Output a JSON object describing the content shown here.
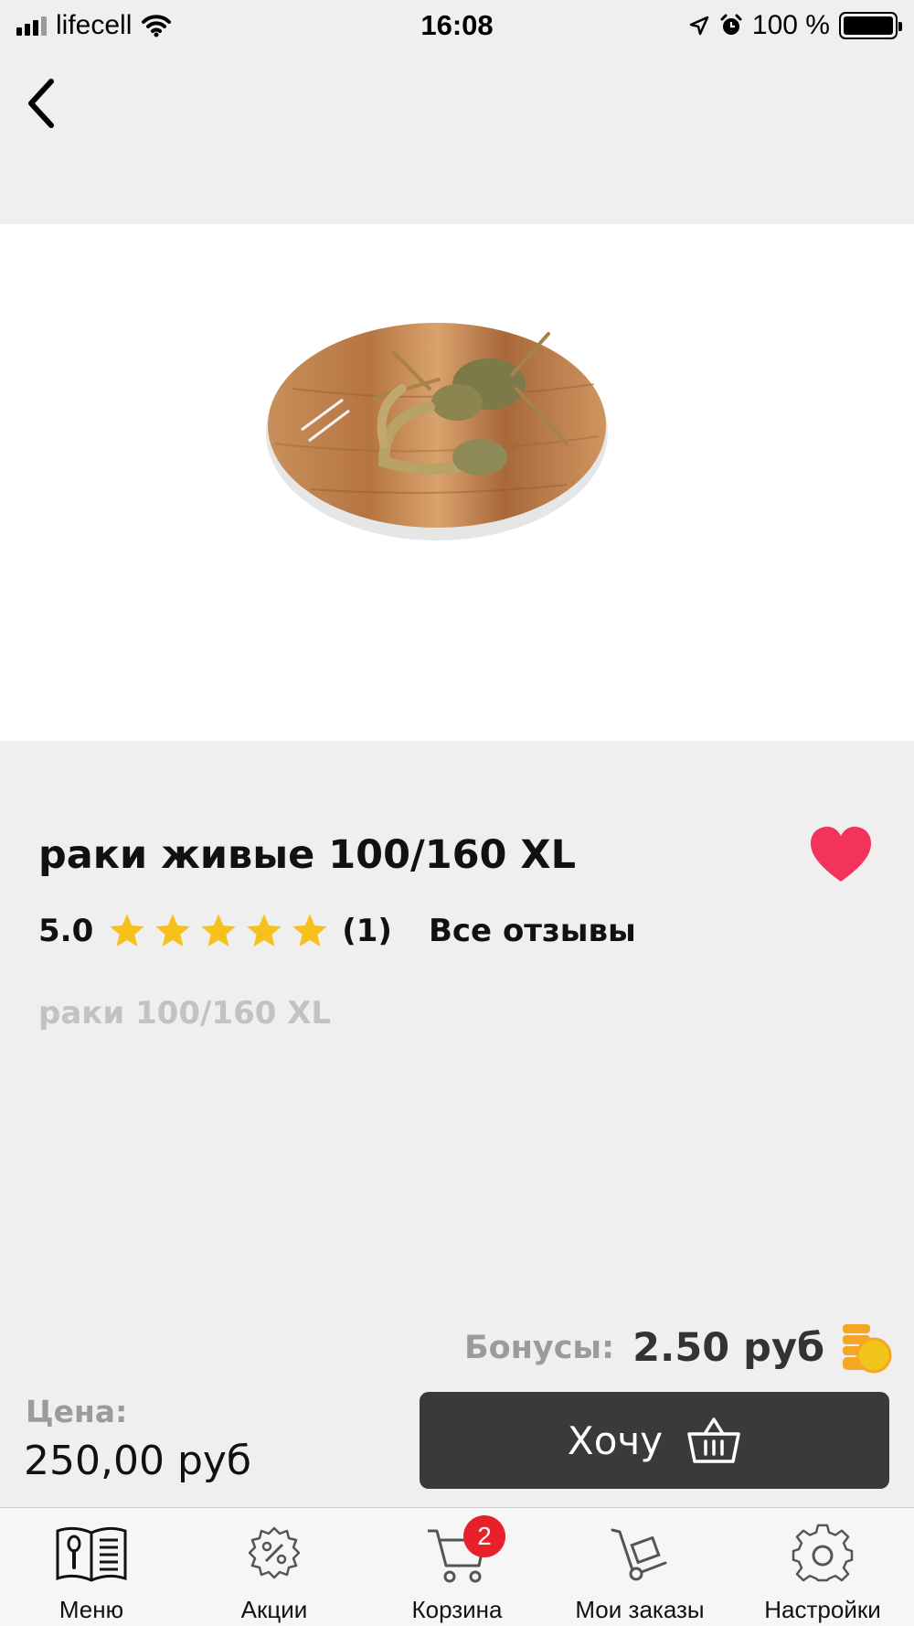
{
  "status_bar": {
    "carrier": "lifecell",
    "time": "16:08",
    "battery_percent": "100 %",
    "signal_bars": 4,
    "icons": [
      "signal-icon",
      "wifi-icon",
      "location-arrow-icon",
      "alarm-icon",
      "battery-icon"
    ]
  },
  "nav": {
    "back_icon": "chevron-left-icon"
  },
  "product": {
    "image": "crayfish-on-wooden-board-photo",
    "title": "раки живые 100/160 XL",
    "favorite": true,
    "favorite_icon": "heart-icon",
    "favorite_color": "#f2335c",
    "rating": "5.0",
    "stars": 5,
    "star_color": "#f7c11d",
    "reviews_count": "(1)",
    "all_reviews_label": "Все отзывы",
    "description": "раки 100/160 XL"
  },
  "bonus": {
    "label": "Бонусы:",
    "value": "2.50 руб",
    "icon": "coins-icon"
  },
  "price": {
    "label": "Цена:",
    "value": "250,00 руб"
  },
  "cta": {
    "label": "Хочу",
    "icon": "basket-icon",
    "background": "#3a3a3a"
  },
  "tab_bar": {
    "items": [
      {
        "label": "Меню",
        "icon": "menu-book-icon"
      },
      {
        "label": "Акции",
        "icon": "discount-gear-icon"
      },
      {
        "label": "Корзина",
        "icon": "cart-icon",
        "badge": "2"
      },
      {
        "label": "Мои заказы",
        "icon": "hand-truck-icon"
      },
      {
        "label": "Настройки",
        "icon": "settings-gear-icon"
      }
    ],
    "badge_color": "#e8202a"
  }
}
